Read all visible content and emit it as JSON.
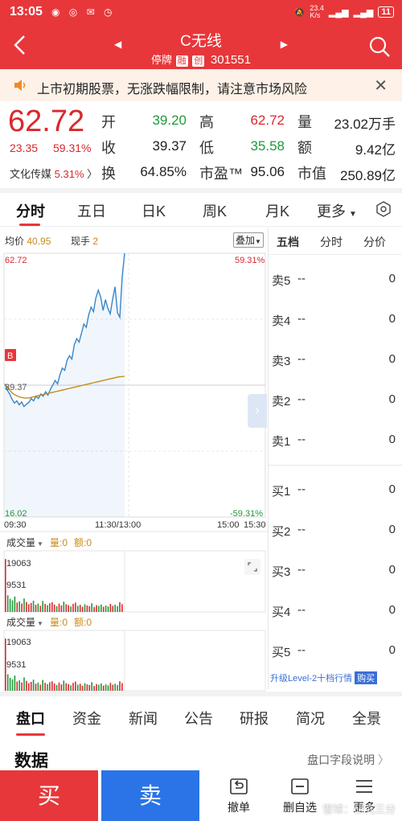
{
  "status_bar": {
    "time": "13:05",
    "net_speed": "23.4\nK/s",
    "battery": "11"
  },
  "header": {
    "title": "C无线",
    "tag1": "停牌",
    "tag2": "融",
    "tag3": "创",
    "code": "301551"
  },
  "notice": {
    "text": "上市初期股票，无涨跌幅限制，请注意市场风险"
  },
  "quote": {
    "price": "62.72",
    "change": "23.35",
    "change_pct": "59.31%",
    "sector_name": "文化传媒",
    "sector_pct": "5.31%",
    "stats": [
      {
        "label": "开",
        "value": "39.20",
        "color": "#1e9a3a"
      },
      {
        "label": "高",
        "value": "62.72",
        "color": "#d8282c"
      },
      {
        "label": "量",
        "value": "23.02万手",
        "color": "#222222"
      },
      {
        "label": "收",
        "value": "39.37",
        "color": "#222222"
      },
      {
        "label": "低",
        "value": "35.58",
        "color": "#1e9a3a"
      },
      {
        "label": "额",
        "value": "9.42亿",
        "color": "#222222"
      },
      {
        "label": "换",
        "value": "64.85%",
        "color": "#222222"
      },
      {
        "label": "市盈™",
        "value": "95.06",
        "color": "#222222"
      },
      {
        "label": "市值",
        "value": "250.89亿",
        "color": "#222222"
      }
    ]
  },
  "kline_tabs": [
    "分时",
    "五日",
    "日K",
    "周K",
    "月K",
    "更多"
  ],
  "kline_more_icon": "triangle-down",
  "chart_info": {
    "avg_label": "均价",
    "avg_value": "40.95",
    "cur_label": "现手",
    "cur_value": "2",
    "overlay": "叠加",
    "y_top": "62.72",
    "y_bottom": "16.02",
    "pct_top": "59.31%",
    "pct_bottom": "-59.31%",
    "y_mid": "39.37",
    "marker": "B",
    "x_labels": [
      "09:30",
      "11:30/13:00",
      "15:00",
      "15:30"
    ]
  },
  "volume_panels": [
    {
      "title": "成交量",
      "vol_label": "量:0",
      "amt_label": "额:0",
      "tick_high": "19063",
      "tick_mid": "9531"
    },
    {
      "title": "成交量",
      "vol_label": "量:0",
      "amt_label": "额:0",
      "tick_high": "19063",
      "tick_mid": "9531"
    }
  ],
  "orderbook": {
    "tabs": [
      "五档",
      "分时",
      "分价"
    ],
    "sells": [
      {
        "label": "卖5",
        "price": "--",
        "qty": "0"
      },
      {
        "label": "卖4",
        "price": "--",
        "qty": "0"
      },
      {
        "label": "卖3",
        "price": "--",
        "qty": "0"
      },
      {
        "label": "卖2",
        "price": "--",
        "qty": "0"
      },
      {
        "label": "卖1",
        "price": "--",
        "qty": "0"
      }
    ],
    "buys": [
      {
        "label": "买1",
        "price": "--",
        "qty": "0"
      },
      {
        "label": "买2",
        "price": "--",
        "qty": "0"
      },
      {
        "label": "买3",
        "price": "--",
        "qty": "0"
      },
      {
        "label": "买4",
        "price": "--",
        "qty": "0"
      },
      {
        "label": "买5",
        "price": "--",
        "qty": "0"
      }
    ],
    "upgrade_text": "升级Level-2十档行情",
    "buy_label": "购买"
  },
  "footer_tabs": [
    "盘口",
    "资金",
    "新闻",
    "公告",
    "研报",
    "简况",
    "全景"
  ],
  "data_section": {
    "title": "数据",
    "link": "盘口字段说明"
  },
  "bottom_bar": {
    "buy": "买",
    "sell": "卖",
    "cancel": "撤单",
    "watchlist": "删自选",
    "more": "更多"
  },
  "watermark": "雪球：研究三分",
  "colors": {
    "brand_red": "#e8373a",
    "up": "#d8282c",
    "down": "#1e9a3a",
    "sell_blue": "#2a74e8",
    "price_line": "#3a86c8",
    "avg_line": "#c88a1a"
  },
  "chart_data": [
    {
      "type": "line",
      "title": "",
      "ylim": [
        16.02,
        62.72
      ],
      "reference_value": 39.37,
      "series": [
        {
          "values": [
            39.6,
            38.5,
            37.8,
            36.9,
            36.2,
            36.6,
            35.9,
            36.4,
            35.6,
            36.0,
            36.3,
            37.0,
            36.6,
            37.4,
            37.0,
            37.8,
            37.4,
            38.2,
            37.6,
            38.6,
            39.4,
            40.2,
            39.6,
            41.2,
            42.4,
            42.0,
            43.8,
            44.6,
            44.0,
            46.5,
            47.6,
            47.0,
            48.6,
            50.2,
            49.6,
            51.8,
            53.2,
            52.4,
            54.8,
            56.2,
            55.0,
            52.6,
            54.5,
            53.0,
            52.0,
            54.6,
            56.8,
            52.2,
            51.4,
            58.6,
            62.72
          ]
        },
        {
          "values": [
            39.5,
            39.0,
            38.5,
            38.0,
            37.7,
            37.5,
            37.3,
            37.2,
            37.1,
            37.1,
            37.1,
            37.2,
            37.3,
            37.4,
            37.5,
            37.6,
            37.7,
            37.8,
            37.9,
            38.0,
            38.1,
            38.2,
            38.3,
            38.4,
            38.5,
            38.6,
            38.7,
            38.8,
            38.9,
            39.0,
            39.1,
            39.2,
            39.3,
            39.4,
            39.5,
            39.6,
            39.7,
            39.8,
            39.9,
            40.0,
            40.1,
            40.2,
            40.3,
            40.4,
            40.5,
            40.6,
            40.7,
            40.8,
            40.85,
            40.9,
            40.95
          ]
        }
      ]
    },
    {
      "type": "bar",
      "ylim": [
        0,
        19063
      ],
      "values": [
        16500,
        5200,
        4100,
        3600,
        4800,
        2900,
        3300,
        2600,
        4200,
        3100,
        2400,
        2800,
        3500,
        2200,
        2600,
        1900,
        3400,
        2500,
        2100,
        2700,
        3000,
        2300,
        1800,
        2600,
        2000,
        3200,
        2400,
        2100,
        1700,
        2500,
        2900,
        1900,
        2200,
        1600,
        2400,
        2000,
        1800,
        2700,
        1500,
        2100,
        1900,
        2300,
        1600,
        2000,
        1700,
        2500,
        1900,
        2200,
        1800,
        3000,
        2400
      ]
    }
  ]
}
